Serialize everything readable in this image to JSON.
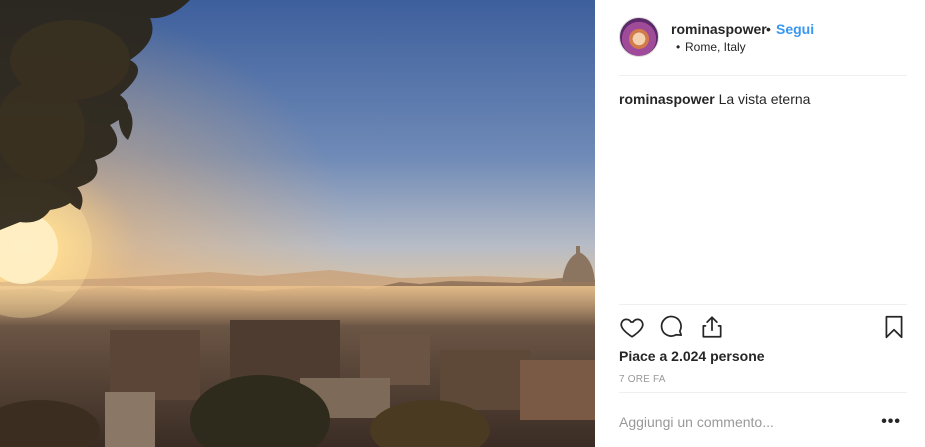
{
  "post": {
    "username": "rominaspower",
    "separator": "•",
    "follow_label": "Segui",
    "location_bullet": "•",
    "location": "Rome, Italy",
    "caption": {
      "user": "rominaspower",
      "text": "La vista eterna"
    },
    "likes": "Piace a 2.024 persone",
    "time": "7 ORE FA",
    "comment_placeholder": "Aggiungi un commento...",
    "more_label": "•••"
  },
  "icons": [
    "heart-icon",
    "comment-icon",
    "share-icon",
    "bookmark-icon",
    "more-icon"
  ],
  "colors": {
    "follow": "#3897f0",
    "text": "#262626",
    "muted": "#999999",
    "divider": "#efefef"
  }
}
